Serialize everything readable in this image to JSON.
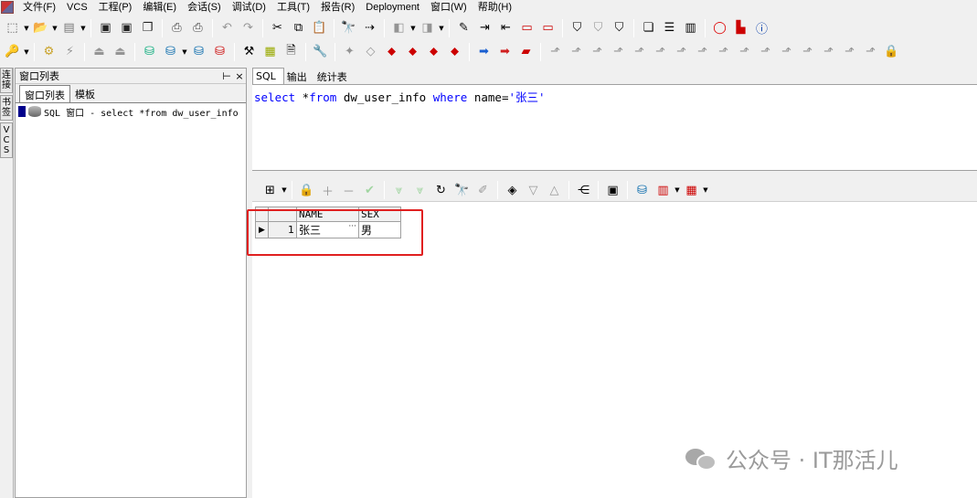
{
  "menubar": {
    "items": [
      "文件(F)",
      "VCS",
      "工程(P)",
      "编辑(E)",
      "会话(S)",
      "调试(D)",
      "工具(T)",
      "报告(R)",
      "Deployment",
      "窗口(W)",
      "帮助(H)"
    ]
  },
  "left_strip": {
    "tabs": [
      "连接",
      "书签",
      "VCS"
    ]
  },
  "left_panel": {
    "title": "窗口列表",
    "pin": "⊢",
    "close": "×",
    "tabs": [
      "窗口列表",
      "模板"
    ],
    "rows": [
      {
        "label": "SQL 窗口 - select *from dw_user_info"
      }
    ]
  },
  "editor_tabs": [
    "SQL",
    "输出",
    "统计表"
  ],
  "editor": {
    "tokens": [
      {
        "text": "select",
        "type": "kw"
      },
      {
        "text": " *",
        "type": "id"
      },
      {
        "text": "from",
        "type": "kw"
      },
      {
        "text": " dw_user_info ",
        "type": "id"
      },
      {
        "text": "where",
        "type": "kw"
      },
      {
        "text": " name=",
        "type": "id"
      },
      {
        "text": "'张三'",
        "type": "str"
      }
    ]
  },
  "grid": {
    "columns": [
      "NAME",
      "SEX"
    ],
    "rows": [
      {
        "num": "1",
        "cells": [
          "张三",
          "男"
        ]
      }
    ],
    "row_pointer": "▶",
    "ellipsis": "···"
  },
  "watermark": {
    "text": "公众号 · IT那活儿"
  },
  "colors": {
    "highlight": "#e02020",
    "keyword": "#0000ff"
  }
}
